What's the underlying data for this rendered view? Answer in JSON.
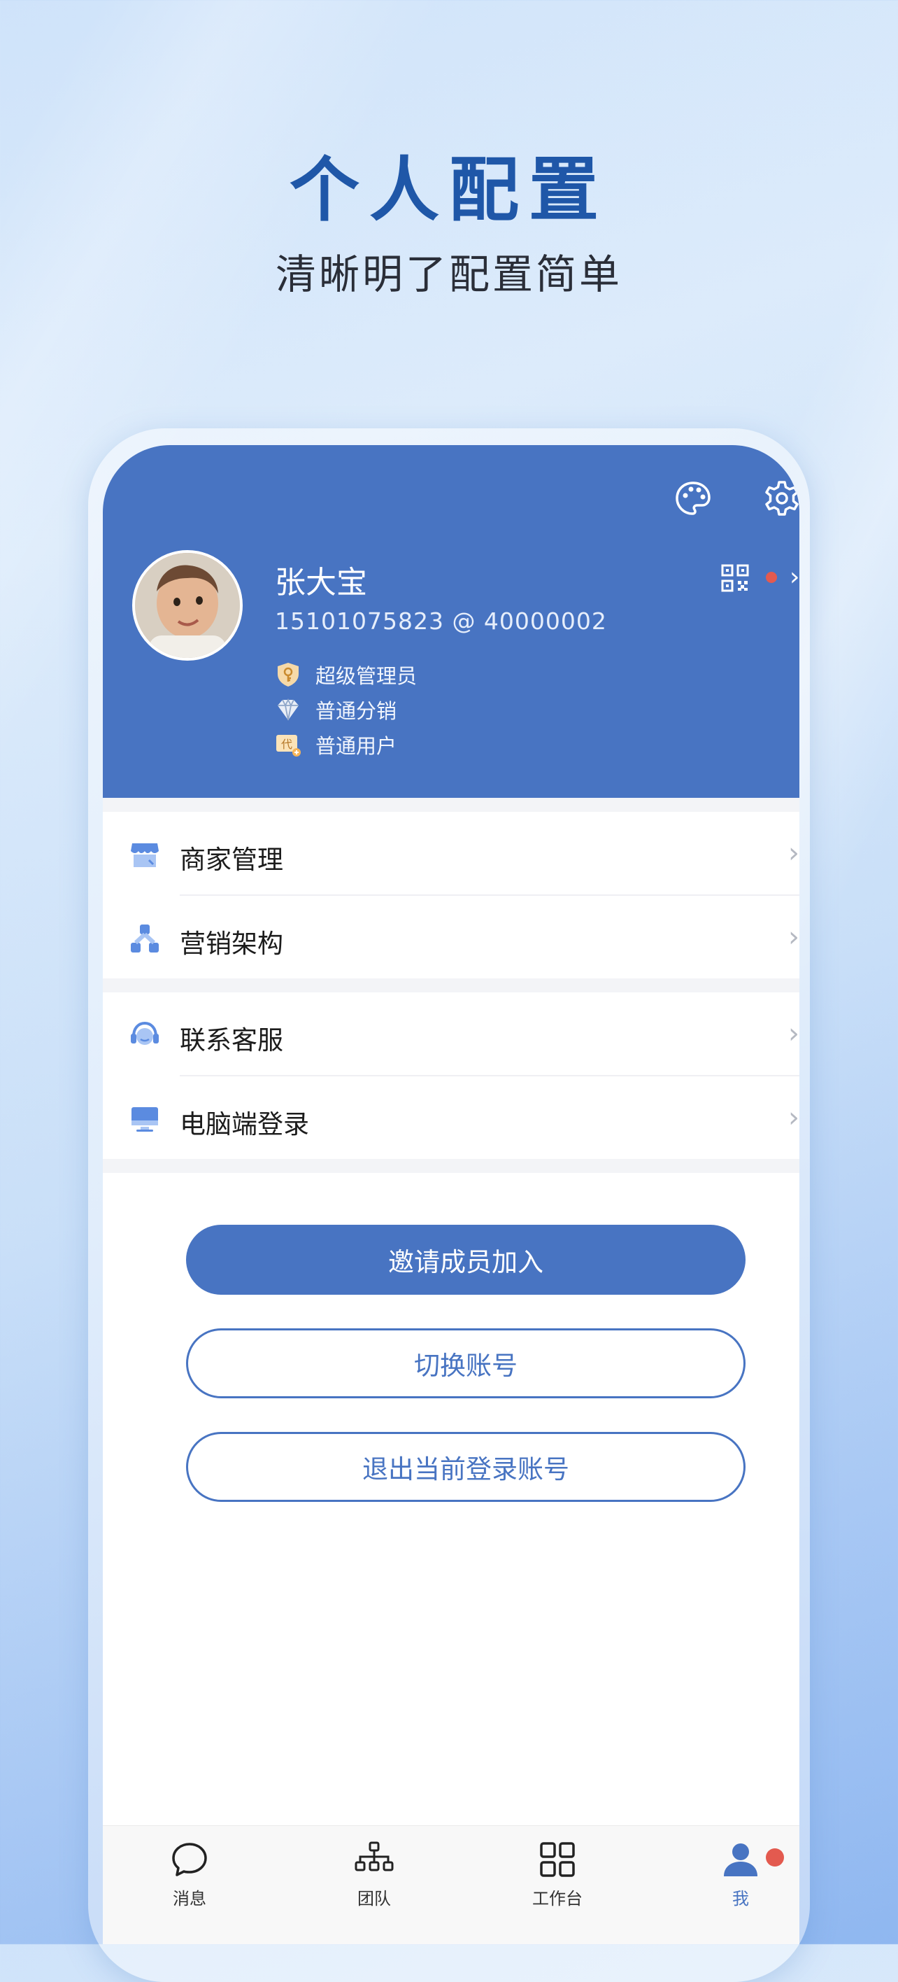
{
  "hero": {
    "title": "个人配置",
    "subtitle": "清晰明了配置简单"
  },
  "profile": {
    "name": "张大宝",
    "id_line": "15101075823 @ 40000002",
    "roles": [
      "超级管理员",
      "普通分销",
      "普通用户"
    ],
    "role_icons": [
      "key-shield-icon",
      "diamond-icon",
      "agent-badge-icon"
    ]
  },
  "header_icons": [
    "palette-icon",
    "settings-icon",
    "qr-code-icon"
  ],
  "menu": {
    "group1": [
      {
        "label": "商家管理",
        "icon": "store-icon"
      },
      {
        "label": "营销架构",
        "icon": "structure-icon"
      }
    ],
    "group2": [
      {
        "label": "联系客服",
        "icon": "headset-icon"
      },
      {
        "label": "电脑端登录",
        "icon": "monitor-icon"
      }
    ]
  },
  "buttons": {
    "invite": "邀请成员加入",
    "switch": "切换账号",
    "logout": "退出当前登录账号"
  },
  "tabs": [
    {
      "label": "消息",
      "icon": "chat-bubble-icon"
    },
    {
      "label": "团队",
      "icon": "org-chart-icon"
    },
    {
      "label": "工作台",
      "icon": "grid-icon"
    },
    {
      "label": "我",
      "icon": "person-icon"
    }
  ],
  "colors": {
    "brand": "#4874c2",
    "title": "#1f57a8",
    "badge": "#e35a4f"
  }
}
